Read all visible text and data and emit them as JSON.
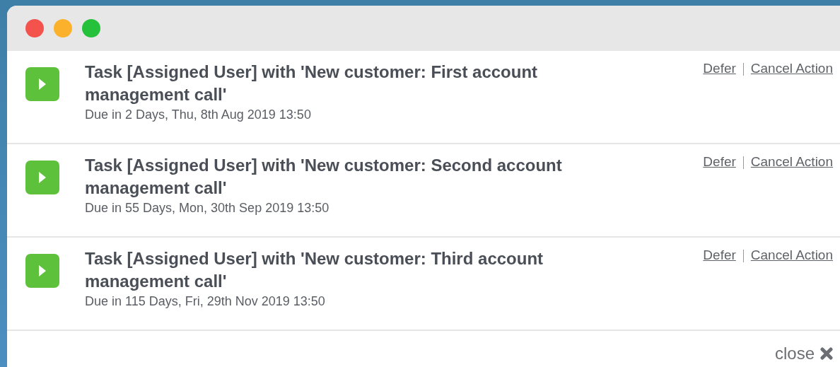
{
  "window": {
    "controls": [
      {
        "color": "#f4524d"
      },
      {
        "color": "#fbb12c"
      },
      {
        "color": "#26c13b"
      }
    ]
  },
  "tasks": [
    {
      "title": "Task [Assigned User] with 'New customer: First account management call'",
      "due": "Due in 2 Days, Thu, 8th Aug 2019 13:50",
      "actions": [
        "Defer",
        "Cancel Action"
      ]
    },
    {
      "title": "Task [Assigned User] with 'New customer: Second account management call'",
      "due": "Due in 55 Days, Mon, 30th Sep 2019 13:50",
      "actions": [
        "Defer",
        "Cancel Action"
      ]
    },
    {
      "title": "Task [Assigned User] with 'New customer: Third account management call'",
      "due": "Due in 115 Days, Fri, 29th Nov 2019 13:50",
      "actions": [
        "Defer",
        "Cancel Action"
      ]
    }
  ],
  "footer": {
    "close": "close"
  }
}
